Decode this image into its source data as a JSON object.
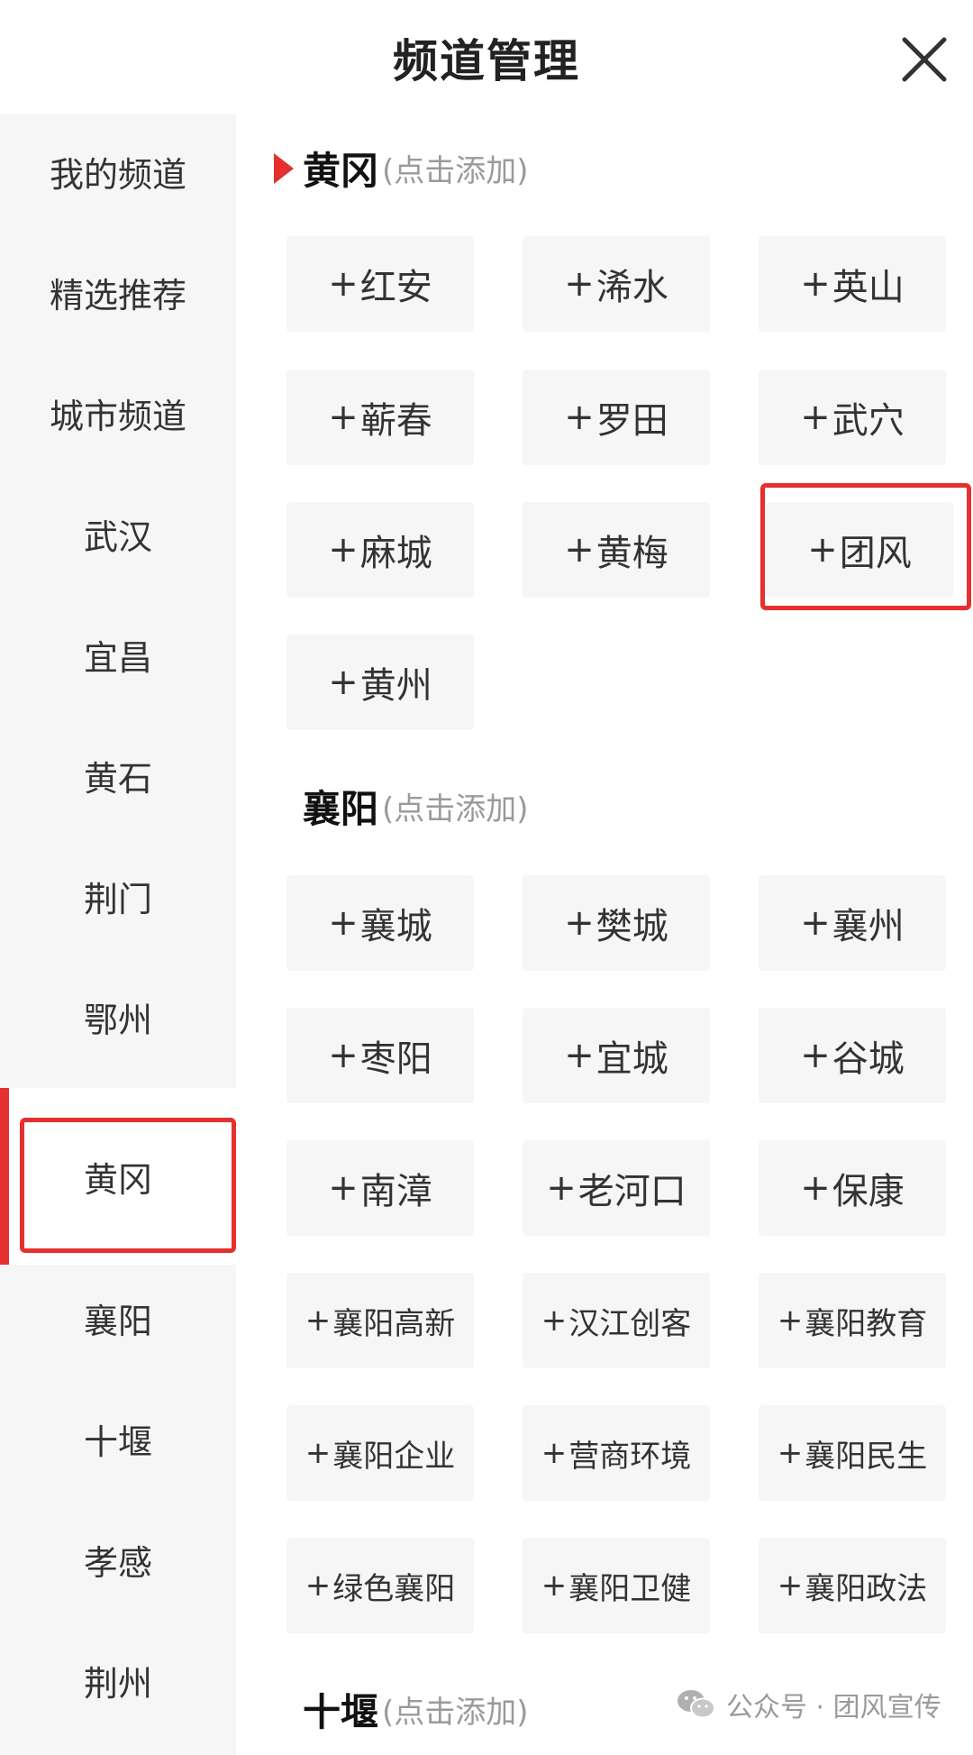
{
  "header": {
    "title": "频道管理"
  },
  "sidebar": {
    "items": [
      {
        "label": "我的频道"
      },
      {
        "label": "精选推荐"
      },
      {
        "label": "城市频道"
      },
      {
        "label": "武汉"
      },
      {
        "label": "宜昌"
      },
      {
        "label": "黄石"
      },
      {
        "label": "荆门"
      },
      {
        "label": "鄂州"
      },
      {
        "label": "黄冈"
      },
      {
        "label": "襄阳"
      },
      {
        "label": "十堰"
      },
      {
        "label": "孝感"
      },
      {
        "label": "荆州"
      }
    ],
    "active_label": "黄冈"
  },
  "sections": [
    {
      "name": "黄冈",
      "hint": "(点击添加)",
      "chips": [
        "红安",
        "浠水",
        "英山",
        "蕲春",
        "罗田",
        "武穴",
        "麻城",
        "黄梅",
        "团风",
        "黄州"
      ]
    },
    {
      "name": "襄阳",
      "hint": "(点击添加)",
      "chips": [
        "襄城",
        "樊城",
        "襄州",
        "枣阳",
        "宜城",
        "谷城",
        "南漳",
        "老河口",
        "保康",
        "襄阳高新",
        "汉江创客",
        "襄阳教育",
        "襄阳企业",
        "营商环境",
        "襄阳民生",
        "绿色襄阳",
        "襄阳卫健",
        "襄阳政法"
      ]
    },
    {
      "name": "十堰",
      "hint": "(点击添加)",
      "chips": []
    }
  ],
  "chip_prefix": "+",
  "watermark": {
    "text": "公众号 · 团风宣传",
    "icon": "wechat-icon"
  },
  "colors": {
    "accent": "#e6302e",
    "chip_bg": "#f6f6f6",
    "sidebar_bg": "#f6f6f6",
    "hint": "#9a9a9a"
  }
}
